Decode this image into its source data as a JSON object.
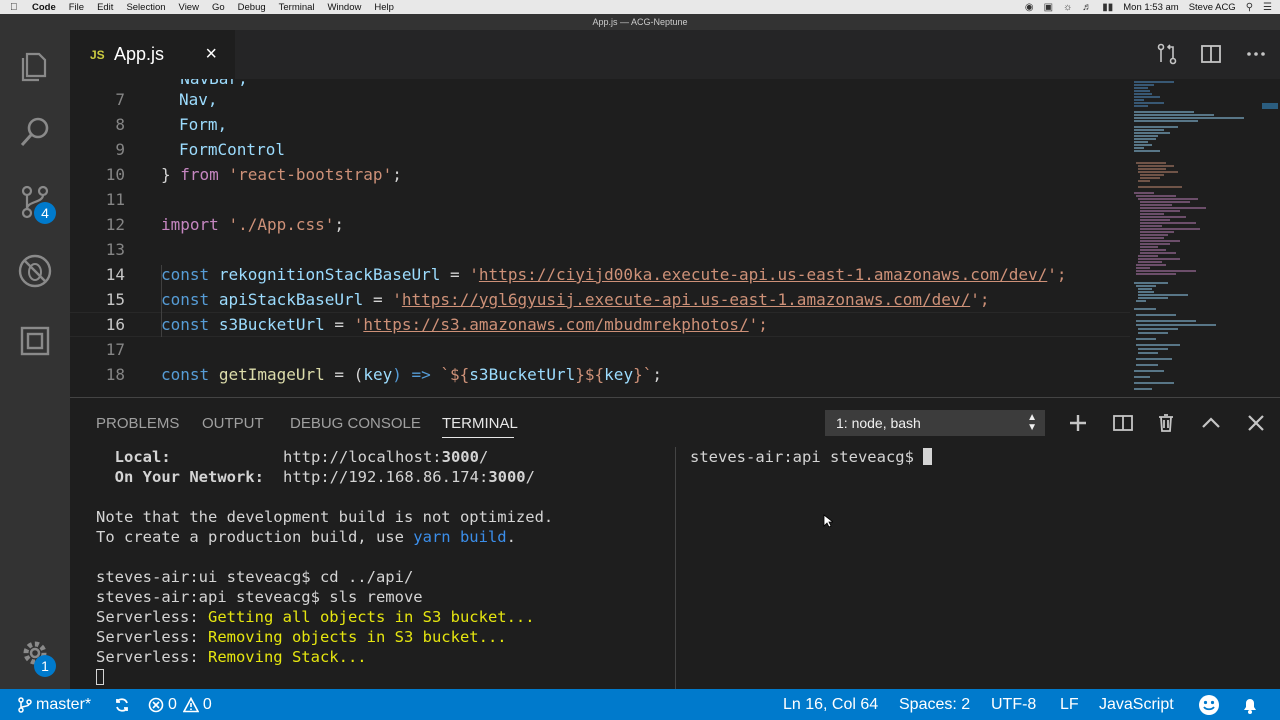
{
  "mac_menubar": {
    "app_name": "Code",
    "menus": [
      "File",
      "Edit",
      "Selection",
      "View",
      "Go",
      "Debug",
      "Terminal",
      "Window",
      "Help"
    ],
    "clock": "Mon 1:53 am",
    "user": "Steve ACG"
  },
  "window": {
    "title": "App.js — ACG-Neptune"
  },
  "activity_bar": {
    "items": [
      "files-icon",
      "search-icon",
      "source-control-icon",
      "debug-icon",
      "extensions-icon"
    ],
    "source_control_badge": "4",
    "settings_badge": "1"
  },
  "tab": {
    "lang": "JS",
    "filename": "App.js",
    "close": "×"
  },
  "editor": {
    "partial_line": "  NavBar,",
    "line_numbers": [
      "7",
      "8",
      "9",
      "10",
      "11",
      "12",
      "13",
      "14",
      "15",
      "16",
      "17",
      "18"
    ],
    "active_line": "16",
    "code": {
      "l7": "Nav,",
      "l8": "Form,",
      "l9": "FormControl",
      "l10_brace": "} ",
      "l10_from": "from",
      "l10_str": "'react-bootstrap'",
      "l10_semi": ";",
      "l12_import": "import",
      "l12_str": "'./App.css'",
      "l12_semi": ";",
      "l14_const": "const",
      "l14_var": "rekognitionStackBaseUrl",
      "l14_eq": " = ",
      "l14_q": "'",
      "l14_url": "https://ciyijd00ka.execute-api.us-east-1.amazonaws.com/dev/",
      "l14_end": "';",
      "l15_const": "const",
      "l15_var": "apiStackBaseUrl",
      "l15_eq": " = ",
      "l15_q": "'",
      "l15_url": "https://ygl6gyusij.execute-api.us-east-1.amazonaws.com/dev/",
      "l15_end": "';",
      "l16_const": "const",
      "l16_var": "s3BucketUrl",
      "l16_eq": " = ",
      "l16_q": "'",
      "l16_url": "https://s3.amazonaws.com/mbudmrekphotos/",
      "l16_end": "';",
      "l18_const": "const",
      "l18_fn": "getImageUrl",
      "l18_eq": " = (",
      "l18_key": "key",
      "l18_arrow": ") => ",
      "l18_tmpl_a": "`${",
      "l18_tmpl_var": "s3BucketUrl",
      "l18_tmpl_b": "}${",
      "l18_tmpl_key": "key",
      "l18_tmpl_c": "}`",
      "l18_semi": ";"
    }
  },
  "panel": {
    "tabs": [
      "PROBLEMS",
      "OUTPUT",
      "DEBUG CONSOLE",
      "TERMINAL"
    ],
    "active_tab": "TERMINAL",
    "terminal_select": "1: node, bash",
    "left_terminal": {
      "local_label": "  Local:",
      "local_url": "http://localhost:",
      "local_port": "3000",
      "local_tail": "/",
      "network_label": "  On Your Network:",
      "network_url": "http://192.168.86.174:",
      "network_port": "3000",
      "network_tail": "/",
      "note1": "Note that the development build is not optimized.",
      "note2_a": "To create a production build, use ",
      "note2_cmd": "yarn build",
      "note2_b": ".",
      "cmd1": "steves-air:ui steveacg$ cd ../api/",
      "cmd2": "steves-air:api steveacg$ sls remove",
      "sls_prefix": "Serverless: ",
      "sls1": "Getting all objects in S3 bucket...",
      "sls2": "Removing objects in S3 bucket...",
      "sls3": "Removing Stack..."
    },
    "right_terminal": {
      "prompt": "steves-air:api steveacg$ "
    }
  },
  "status_bar": {
    "branch": "master*",
    "errors": "0",
    "warnings": "0",
    "position": "Ln 16, Col 64",
    "spaces": "Spaces: 2",
    "encoding": "UTF-8",
    "eol": "LF",
    "language": "JavaScript"
  },
  "colors": {
    "status_bar": "#007acc",
    "activity_bar": "#333333",
    "editor_bg": "#1e1e1e"
  }
}
